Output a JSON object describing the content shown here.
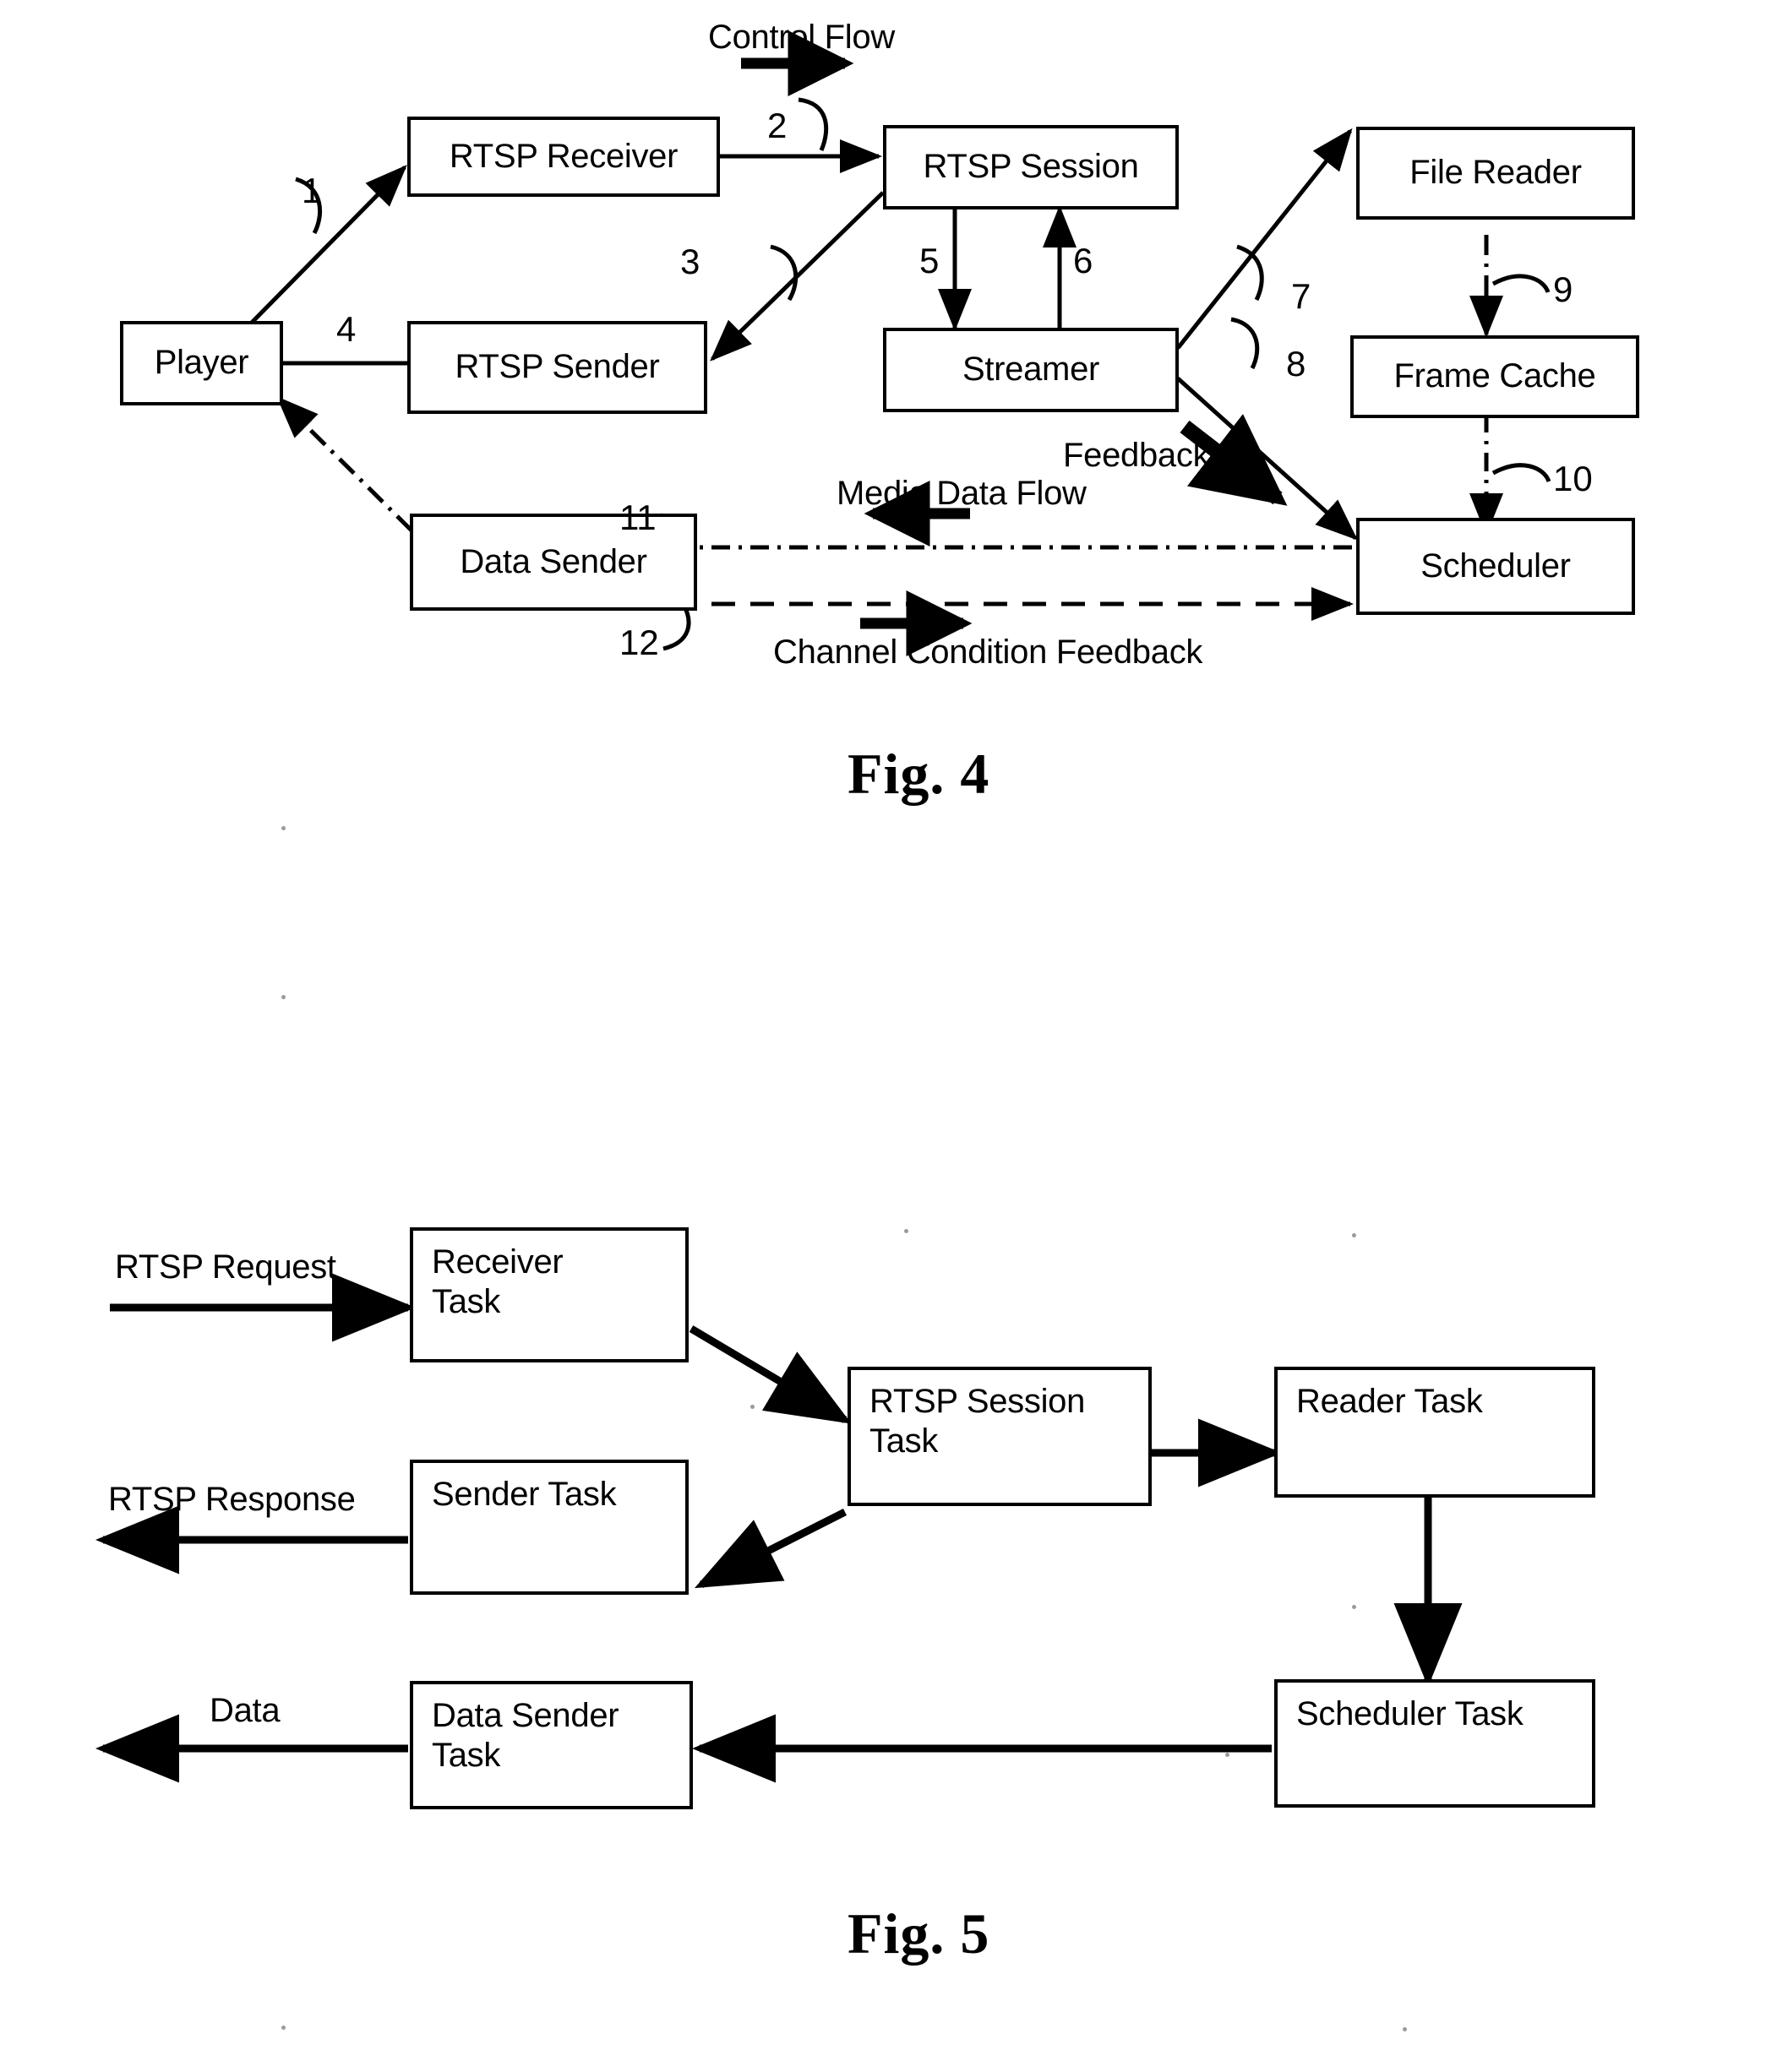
{
  "figures": [
    {
      "id": "fig4",
      "caption": "Fig. 4",
      "flow_labels": {
        "control_flow": "Control Flow",
        "media_data_flow": "Media Data Flow",
        "channel_condition_feedback": "Channel Condition Feedback",
        "feedback": "Feedback"
      },
      "boxes": [
        {
          "key": "player",
          "label": "Player"
        },
        {
          "key": "rtsp_receiver",
          "label": "RTSP Receiver"
        },
        {
          "key": "rtsp_sender",
          "label": "RTSP Sender"
        },
        {
          "key": "rtsp_session",
          "label": "RTSP Session"
        },
        {
          "key": "streamer",
          "label": "Streamer"
        },
        {
          "key": "file_reader",
          "label": "File Reader"
        },
        {
          "key": "frame_cache",
          "label": "Frame Cache"
        },
        {
          "key": "scheduler",
          "label": "Scheduler"
        },
        {
          "key": "data_sender",
          "label": "Data Sender"
        }
      ],
      "connector_numbers": [
        "1",
        "2",
        "3",
        "4",
        "5",
        "6",
        "7",
        "8",
        "9",
        "10",
        "11",
        "12"
      ]
    },
    {
      "id": "fig5",
      "caption": "Fig. 5",
      "io_labels": {
        "rtsp_request": "RTSP Request",
        "rtsp_response": "RTSP Response",
        "data": "Data"
      },
      "boxes": [
        {
          "key": "receiver_task",
          "label": "Receiver\nTask"
        },
        {
          "key": "rtsp_session_task",
          "label": "RTSP Session\nTask"
        },
        {
          "key": "reader_task",
          "label": "Reader Task"
        },
        {
          "key": "sender_task",
          "label": "Sender Task"
        },
        {
          "key": "data_sender_task",
          "label": "Data Sender\nTask"
        },
        {
          "key": "scheduler_task",
          "label": "Scheduler Task"
        }
      ]
    }
  ],
  "colors": {
    "ink": "#000000",
    "paper": "#ffffff"
  }
}
